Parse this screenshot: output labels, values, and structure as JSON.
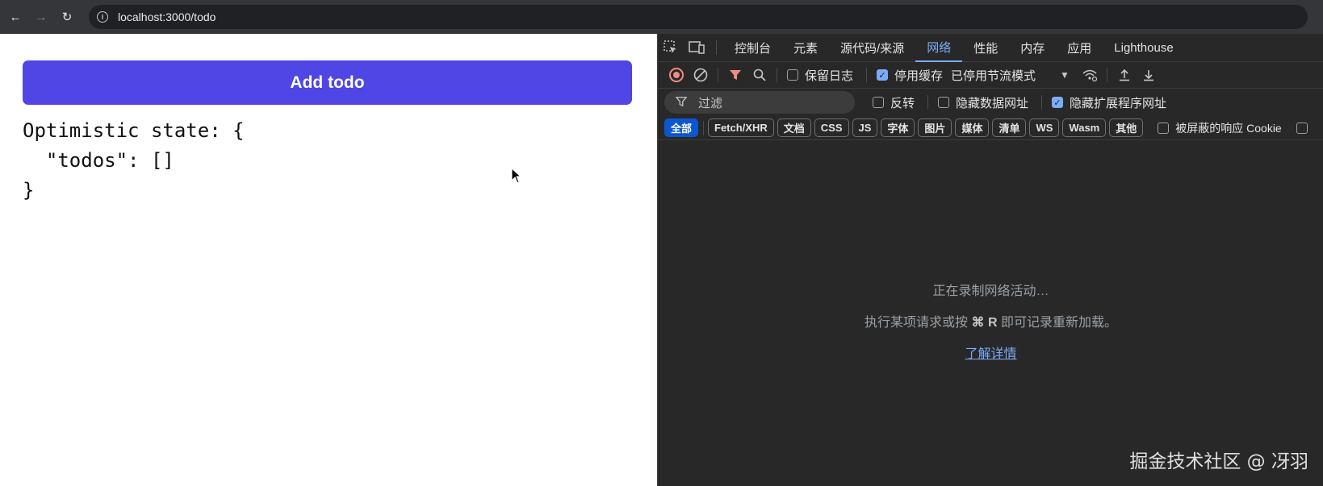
{
  "browser": {
    "back_icon": "←",
    "forward_icon": "→",
    "reload_icon": "↻",
    "url": "localhost:3000/todo"
  },
  "page": {
    "add_button_label": "Add todo",
    "state_text": "Optimistic state: {\n  \"todos\": []\n}",
    "accent_color": "#4f46e5"
  },
  "devtools": {
    "tabs": [
      {
        "label": "控制台"
      },
      {
        "label": "元素"
      },
      {
        "label": "源代码/来源"
      },
      {
        "label": "网络"
      },
      {
        "label": "性能"
      },
      {
        "label": "内存"
      },
      {
        "label": "应用"
      },
      {
        "label": "Lighthouse"
      }
    ],
    "active_tab": "网络",
    "toolbar": {
      "preserve_log": "保留日志",
      "disable_cache": "停用缓存",
      "throttling": "已停用节流模式"
    },
    "filter": {
      "placeholder": "过滤",
      "invert": "反转",
      "hide_data_urls": "隐藏数据网址",
      "hide_extension_urls": "隐藏扩展程序网址"
    },
    "types": [
      "全部",
      "Fetch/XHR",
      "文档",
      "CSS",
      "JS",
      "字体",
      "图片",
      "媒体",
      "清单",
      "WS",
      "Wasm",
      "其他"
    ],
    "blocked_cookies": "被屏蔽的响应 Cookie",
    "empty_state": {
      "line1": "正在录制网络活动…",
      "line2_prefix": "执行某项请求或按 ",
      "line2_key": "⌘ R",
      "line2_suffix": " 即可记录重新加载。",
      "learn_more": "了解详情"
    }
  },
  "watermark": "掘金技术社区 @ 冴羽"
}
